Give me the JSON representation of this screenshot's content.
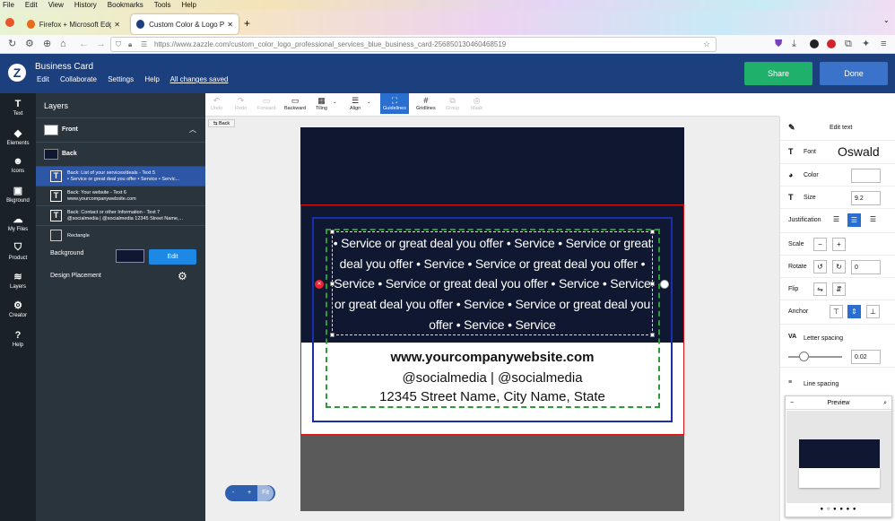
{
  "browser": {
    "menu": [
      "File",
      "Edit",
      "View",
      "History",
      "Bookmarks",
      "Tools",
      "Help"
    ],
    "tabs": [
      {
        "title": "Firefox + Microsoft Edge bug w"
      },
      {
        "title": "Custom Color & Logo Professi"
      }
    ],
    "url": "https://www.zazzle.com/custom_color_logo_professional_services_blue_business_card-256850130460468519"
  },
  "app": {
    "title": "Business Card",
    "menu": [
      "Edit",
      "Collaborate",
      "Settings",
      "Help"
    ],
    "saved_status": "All changes saved",
    "share_label": "Share",
    "done_label": "Done",
    "accent": "#1c3f7e"
  },
  "rail": [
    {
      "label": "Text"
    },
    {
      "label": "Elements"
    },
    {
      "label": "Icons"
    },
    {
      "label": "Bkground"
    },
    {
      "label": "My Files"
    },
    {
      "label": "Product"
    },
    {
      "label": "Layers"
    },
    {
      "label": "Creator"
    },
    {
      "label": "Help"
    }
  ],
  "layers": {
    "title": "Layers",
    "front_label": "Front",
    "back_label": "Back",
    "items": [
      {
        "title": "Back: List of your services/deals - Text 5",
        "sub": "• Service or great deal you offer • Service • Servic..."
      },
      {
        "title": "Back: Your website - Text 6",
        "sub": "www.yourcompanywebsite.com"
      },
      {
        "title": "Back: Contact or other Information - Text 7",
        "sub": "@socialmedia | @socialmedia 12345 Street Name,..."
      },
      {
        "title": "Rectangle",
        "sub": ""
      }
    ],
    "background_label": "Background",
    "edit_label": "Edit",
    "design_placement_label": "Design Placement"
  },
  "toolbar": {
    "undo": "Undo",
    "redo": "Redo",
    "forward": "Forward",
    "backward": "Backward",
    "tiling": "Tiling",
    "align": "Align",
    "guidelines": "Guidelines",
    "gridlines": "Gridlines",
    "group": "Group",
    "mask": "Mask",
    "back_button": "Back"
  },
  "card": {
    "services_text": "• Service or great deal you offer • Service • Service or great deal you offer • Service • Service or great deal you offer • Service • Service or great deal you offer • Service • Service or great deal you offer • Service • Service or great deal you offer • Service • Service",
    "website": "www.yourcompanywebsite.com",
    "social": "@socialmedia | @socialmedia",
    "address": "12345 Street Name, City Name, State",
    "background_color": "#0f1830"
  },
  "zoom": {
    "minus": "-",
    "plus": "+",
    "fit": "Fit"
  },
  "right_panel": {
    "edit_text": "Edit text",
    "font_label": "Font",
    "font_value": "Oswald",
    "color_label": "Color",
    "size_label": "Size",
    "size_value": "9.2",
    "justification_label": "Justification",
    "scale_label": "Scale",
    "rotate_label": "Rotate",
    "rotate_value": "0",
    "flip_label": "Flip",
    "anchor_label": "Anchor",
    "letter_spacing_label": "Letter spacing",
    "letter_spacing_value": "0.02",
    "line_spacing_label": "Line spacing",
    "preview_label": "Preview"
  }
}
